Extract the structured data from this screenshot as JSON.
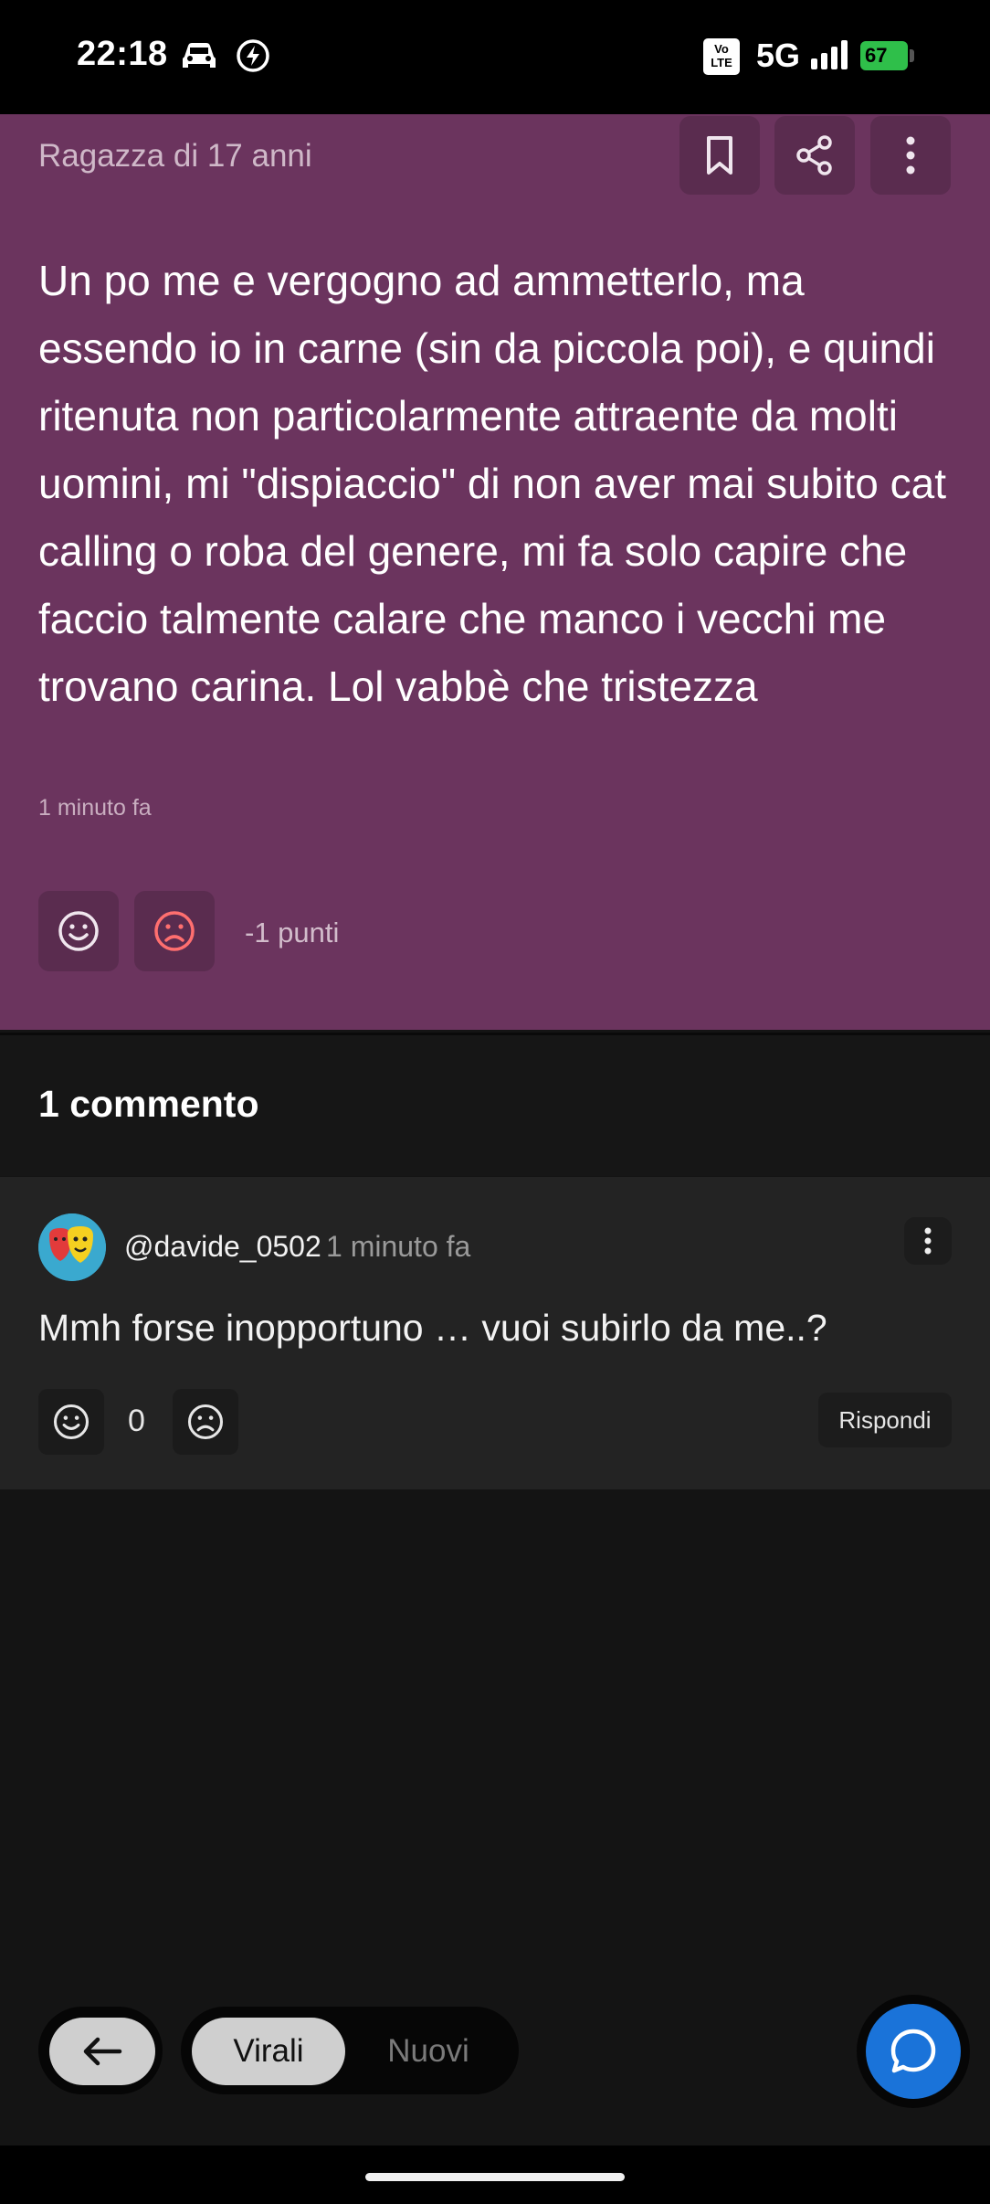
{
  "status_bar": {
    "time": "22:18",
    "volte": "Vo LTE",
    "network": "5G",
    "battery": "67",
    "icons": [
      "car-icon",
      "charging-bolt-icon",
      "volte-icon",
      "signal-icon",
      "battery-icon"
    ]
  },
  "post": {
    "author": "Ragazza di 17 anni",
    "text": "Un po me e vergogno ad ammetterlo, ma essendo io in carne (sin da piccola poi), e quindi ritenuta non particolarmente attraente da molti uomini, mi \"dispiaccio\" di non aver mai subito cat calling o roba del genere, mi fa solo capire che faccio talmente calare che manco i vecchi me trovano carina. Lol vabbè che tristezza",
    "time": "1 minuto fa",
    "points": "-1 punti",
    "actions": [
      "bookmark-icon",
      "share-icon",
      "more-vertical-icon"
    ],
    "accent_color": "#6b345e"
  },
  "comments": {
    "header": "1 commento",
    "items": [
      {
        "user": "@davide_0502",
        "time": "1 minuto fa",
        "text": "Mmh forse inopportuno … vuoi subirlo da me..?",
        "score": "0",
        "reply_label": "Rispondi"
      }
    ]
  },
  "bottom_bar": {
    "tabs": [
      {
        "label": "Virali",
        "active": true
      },
      {
        "label": "Nuovi",
        "active": false
      }
    ],
    "fab_color": "#1a73d9"
  }
}
